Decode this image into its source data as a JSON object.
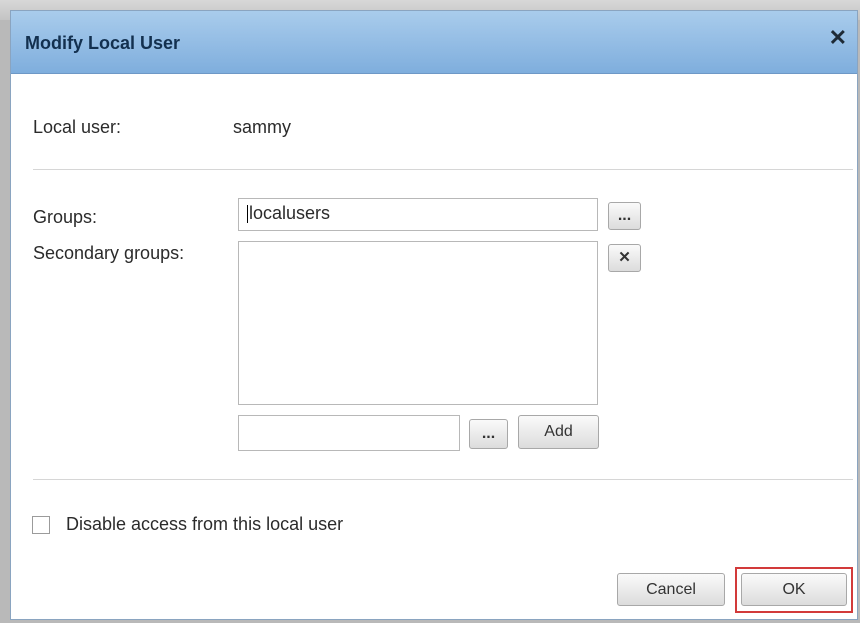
{
  "dialog": {
    "title": "Modify Local User",
    "close_glyph": "✕"
  },
  "user": {
    "label": "Local user:",
    "value": "sammy"
  },
  "groups": {
    "label": "Groups:",
    "value": "localusers",
    "browse_label": "..."
  },
  "secondary_groups": {
    "label": "Secondary groups:",
    "remove_label": "✕",
    "input_value": "",
    "browse_label": "...",
    "add_label": "Add"
  },
  "options": {
    "disable_access_label": "Disable access from this local user",
    "disable_access_checked": false
  },
  "footer": {
    "cancel_label": "Cancel",
    "ok_label": "OK",
    "ok_highlight_color": "#d23a3a"
  },
  "colors": {
    "titlebar_top": "#a9ccec",
    "titlebar_bottom": "#7faedd",
    "title_text": "#13304f"
  }
}
